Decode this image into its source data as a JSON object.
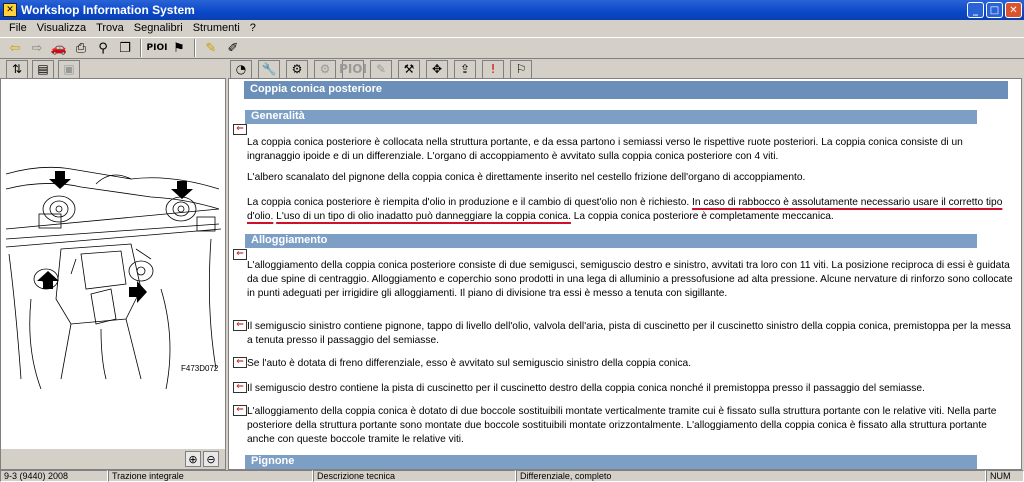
{
  "window": {
    "title": "Workshop Information System"
  },
  "menu": [
    "File",
    "Visualizza",
    "Trova",
    "Segnalibri",
    "Strumenti",
    "?"
  ],
  "toolbar": {
    "pioi_label": "PIOI",
    "pioi2_label": "PIOI"
  },
  "figure": {
    "code": "F473D072"
  },
  "content": {
    "header": "Coppia conica posteriore",
    "section1": "Generalità",
    "p1": "La coppia conica posteriore è collocata nella struttura portante, e da essa partono i semiassi verso le rispettive ruote posteriori. La coppia conica consiste di un ingranaggio ipoide e di un differenziale. L'organo di accoppiamento è avvitato sulla coppia conica posteriore con 4 viti.",
    "p2": "L'albero scanalato del pignone della coppia conica è direttamente inserito nel cestello frizione dell'organo di accoppiamento.",
    "p3a": "La coppia conica posteriore è riempita d'olio in produzione e il cambio di quest'olio non è richiesto. ",
    "p3b": "In caso di rabbocco è assolutamente necessario usare il corretto tipo d'olio.",
    "p3c": " ",
    "p3d": "L'uso di un tipo di olio inadatto può danneggiare la coppia conica.",
    "p3e": " La coppia conica posteriore è completamente meccanica.",
    "section2": "Alloggiamento",
    "p4": "L'alloggiamento della coppia conica posteriore consiste di due semigusci, semiguscio destro e sinistro, avvitati tra loro con 11 viti. La posizione reciproca di essi è guidata da due spine di centraggio. Alloggiamento e coperchio sono prodotti in una lega di alluminio a pressofusione ad alta pressione. Alcune nervature di rinforzo sono collocate in punti adeguati per irrigidire gli alloggiamenti. Il piano di divisione tra essi è messo a tenuta con sigillante.",
    "p5": "Il semiguscio sinistro contiene pignone, tappo di livello dell'olio, valvola dell'aria, pista di cuscinetto per il cuscinetto sinistro della coppia conica, premistoppa per la messa a tenuta presso il passaggio del semiasse.",
    "p6": "Se l'auto è dotata di freno differenziale, esso è avvitato sul semiguscio sinistro della coppia conica.",
    "p7": "Il semiguscio destro contiene la pista di cuscinetto per il cuscinetto destro della coppia conica nonché il premistoppa presso il passaggio del semiasse.",
    "p8": "L'alloggiamento della coppia conica è dotato di due boccole sostituibili montate verticalmente tramite cui è fissato sulla struttura portante con le relative viti. Nella parte posteriore della struttura portante sono montate due boccole sostituibili montate orizzontalmente. L'alloggiamento della coppia conica è fissato alla struttura portante anche con queste boccole tramite le relative viti.",
    "section3": "Pignone"
  },
  "status": {
    "vehicle": "9-3 (9440) 2008",
    "drive": "Trazione integrale",
    "doc_type": "Descrizione tecnica",
    "component": "Differenziale, completo",
    "num": "NUM"
  },
  "colors": {
    "title_bar": "#0a48c8",
    "section_bg": "#7d9fc6",
    "highlight": "#d0102a"
  }
}
